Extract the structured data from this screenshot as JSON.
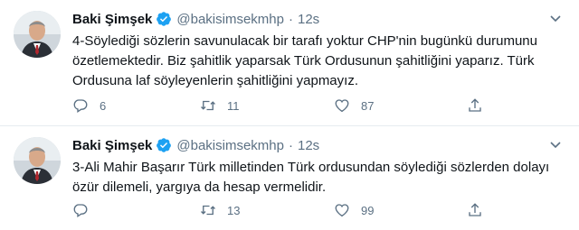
{
  "tweets": [
    {
      "author_name": "Baki Şimşek",
      "handle": "@bakisimsekmhp",
      "separator": "·",
      "time": "12s",
      "text": "4-Söylediği sözlerin savunulacak bir tarafı yoktur CHP'nin bugünkü durumunu özetlemektedir. Biz şahitlik yaparsak Türk Ordusunun şahitliğini yaparız. Türk Ordusuna laf söyleyenlerin şahitliğini yapmayız.",
      "replies": "6",
      "retweets": "11",
      "likes": "87"
    },
    {
      "author_name": "Baki Şimşek",
      "handle": "@bakisimsekmhp",
      "separator": "·",
      "time": "12s",
      "text": "3-Ali Mahir Başarır Türk milletinden Türk ordusundan söylediği sözlerden dolayı özür dilemeli, yargıya da hesap vermelidir.",
      "replies": "",
      "retweets": "13",
      "likes": "99"
    }
  ],
  "colors": {
    "text": "#0f1419",
    "secondary": "#5b7083",
    "verified": "#1da1f2",
    "divider": "#e6ecf0"
  },
  "icons": {
    "verified": "verified-badge-icon",
    "more": "chevron-down-icon",
    "reply": "reply-icon",
    "retweet": "retweet-icon",
    "like": "heart-icon",
    "share": "share-icon"
  }
}
